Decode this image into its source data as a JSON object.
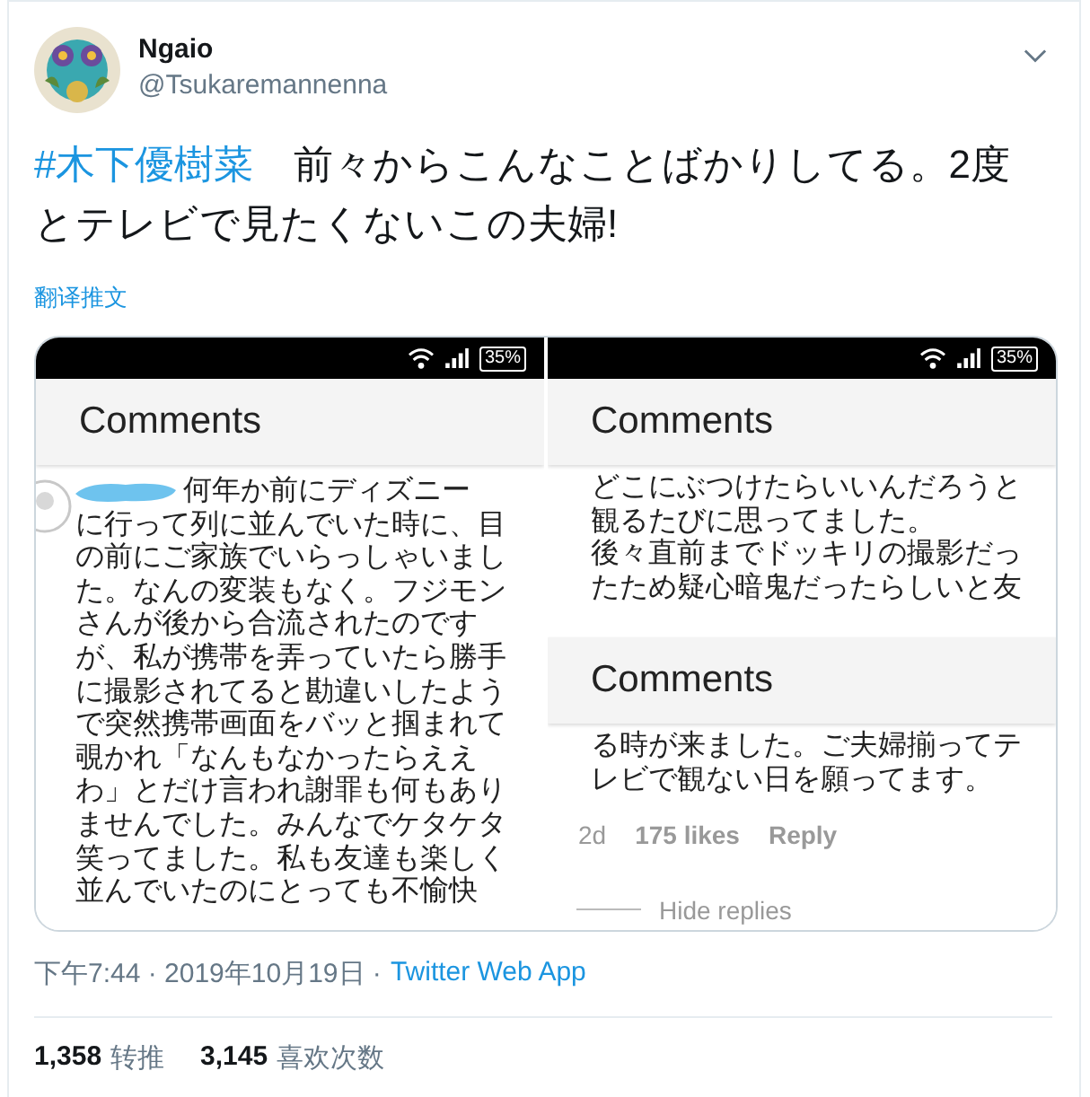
{
  "tweet": {
    "author": {
      "name": "Ngaio",
      "handle": "@Tsukaremannenna"
    },
    "hashtag": "#木下優樹菜",
    "text": "前々からこんなことばかりしてる。2度とテレビで見たくないこの夫婦!",
    "translate_link": "翻译推文",
    "images": [
      {
        "battery": "35%",
        "blocks": [
          {
            "kind": "header",
            "text": "Comments"
          },
          {
            "kind": "comment",
            "redacted": true,
            "lines": [
              "何年か前にディズニー",
              "に行って列に並んでいた時に、目",
              "の前にご家族でいらっしゃいまし",
              "た。なんの変装もなく。フジモン",
              "さんが後から合流されたのです",
              "が、私が携帯を弄っていたら勝手",
              "に撮影されてると勘違いしたよう",
              "で突然携帯画面をバッと掴まれて",
              "覗かれ「なんもなかったらええ",
              "わ」とだけ言われ謝罪も何もあり",
              "ませんでした。みんなでケタケタ",
              "笑ってました。私も友達も楽しく",
              "並んでいたのにとっても不愉快"
            ]
          }
        ]
      },
      {
        "battery": "35%",
        "blocks": [
          {
            "kind": "header",
            "text": "Comments"
          },
          {
            "kind": "lines",
            "lines": [
              "どこにぶつけたらいいんだろうと",
              "観るたびに思ってました。",
              "後々直前までドッキリの撮影だっ",
              "たため疑心暗鬼だったらしいと友"
            ]
          },
          {
            "kind": "header",
            "text": "Comments"
          },
          {
            "kind": "lines",
            "lines": [
              "る時が来ました。ご夫婦揃ってテ",
              "レビで観ない日を願ってます。"
            ]
          },
          {
            "kind": "meta",
            "age": "2d",
            "likes": "175 likes",
            "reply": "Reply"
          },
          {
            "kind": "hide",
            "text": "Hide replies"
          }
        ]
      }
    ],
    "timestamp": "下午7:44 · 2019年10月19日 ·",
    "source": "Twitter Web App",
    "stats": [
      {
        "count": "1,358",
        "label": "转推"
      },
      {
        "count": "3,145",
        "label": "喜欢次数"
      }
    ]
  }
}
